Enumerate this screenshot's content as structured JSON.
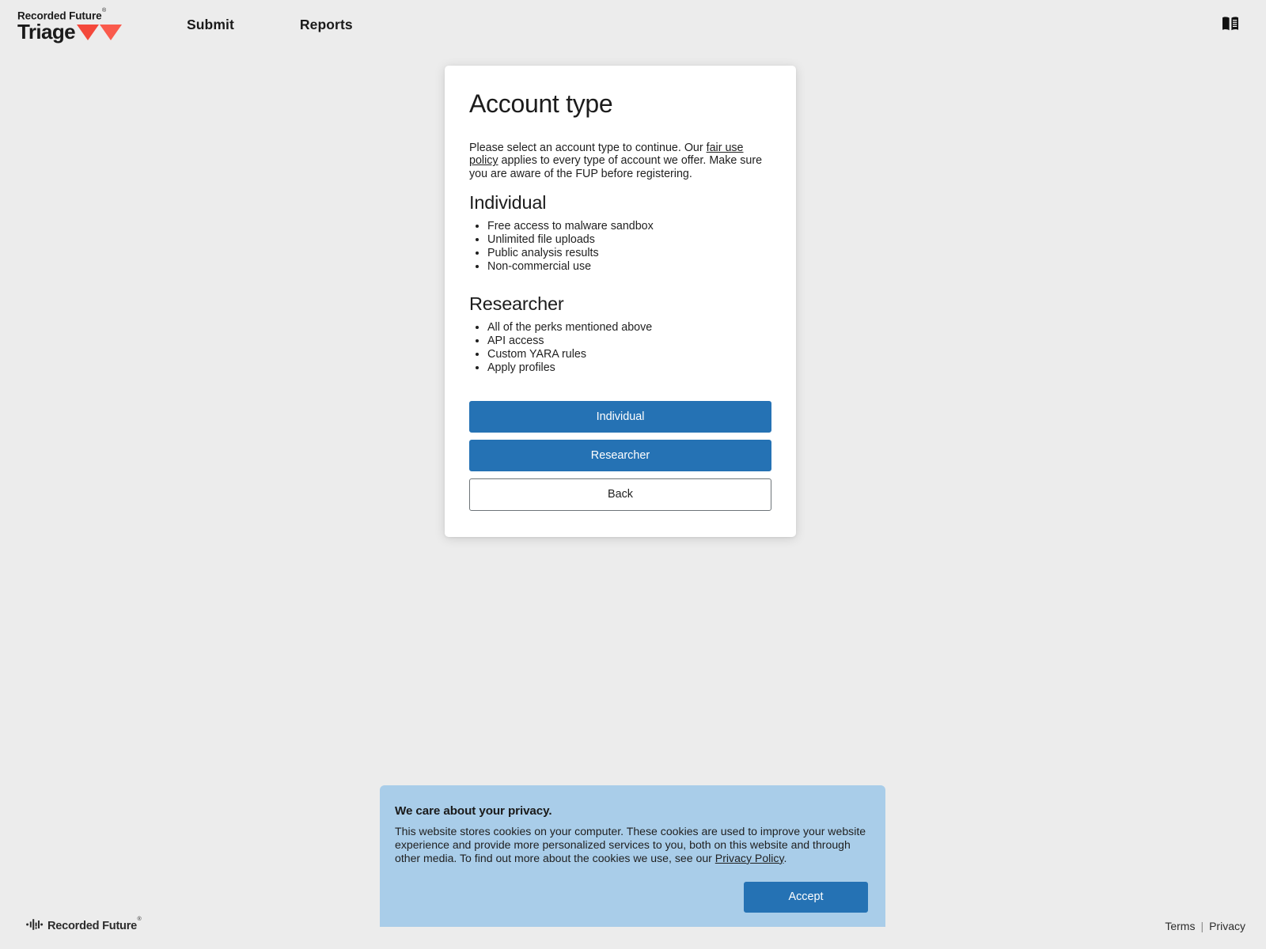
{
  "navbar": {
    "brand": {
      "top_text": "Recorded Future",
      "registered_mark": "®",
      "bottom_text": "Triage",
      "logo_icon": "triangles-icon"
    },
    "links": [
      {
        "label": "Submit",
        "name": "nav-link-submit"
      },
      {
        "label": "Reports",
        "name": "nav-link-reports"
      }
    ],
    "docs_icon": "open-book-icon"
  },
  "card": {
    "title": "Account type",
    "intro": {
      "before_link": "Please select an account type to continue. Our ",
      "link": "fair use policy",
      "after_link": " applies to every type of account we offer. Make sure you are aware of the FUP before registering."
    },
    "tiers": [
      {
        "name": "Individual",
        "perks": [
          "Free access to malware sandbox",
          "Unlimited file uploads",
          "Public analysis results",
          "Non-commercial use"
        ]
      },
      {
        "name": "Researcher",
        "perks": [
          "All of the perks mentioned above",
          "API access",
          "Custom YARA rules",
          "Apply profiles"
        ]
      }
    ],
    "buttons": {
      "individual": "Individual",
      "researcher": "Researcher",
      "back": "Back"
    }
  },
  "cookie_banner": {
    "title": "We care about your privacy.",
    "body_before_link": "This website stores cookies on your computer. These cookies are used to improve your website experience and provide more personalized services to you, both on this website and through other media. To find out more about the cookies we use, see our ",
    "privacy_link": "Privacy Policy",
    "body_after_link": ".",
    "accept_label": "Accept"
  },
  "footer": {
    "brand_text": "Recorded Future",
    "brand_mark": "®",
    "logo_icon": "waveform-icon",
    "terms_label": "Terms",
    "separator": "|",
    "privacy_label": "Privacy"
  },
  "colors": {
    "page_background": "#ececec",
    "card_background": "#ffffff",
    "primary_button": "#2572b4",
    "cookie_banner_background": "#a9cde9",
    "logo_red": "#f4483b"
  }
}
